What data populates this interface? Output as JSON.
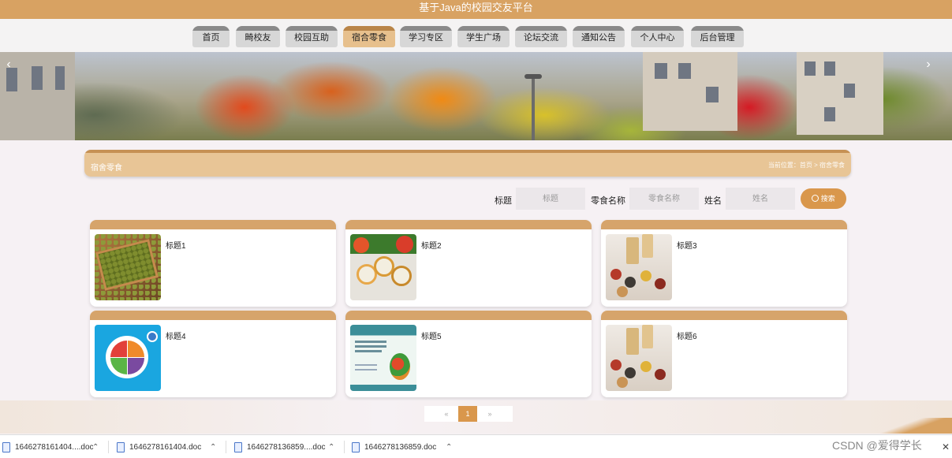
{
  "app": {
    "title": "基于Java的校园交友平台"
  },
  "nav": {
    "items": [
      {
        "label": "首页"
      },
      {
        "label": "畸校友"
      },
      {
        "label": "校园互助"
      },
      {
        "label": "宿合零食"
      },
      {
        "label": "学习专区"
      },
      {
        "label": "学生广场"
      },
      {
        "label": "论坛交流"
      },
      {
        "label": "通知公告"
      },
      {
        "label": "个人中心"
      },
      {
        "label": "后台管理"
      }
    ],
    "active_index": 3
  },
  "banner": {
    "prev_icon": "chevron-left-icon",
    "next_icon": "chevron-right-icon"
  },
  "section": {
    "title": "宿舍零食",
    "crumb": "当前位置：首页 > 宿舍零食"
  },
  "search": {
    "fields": [
      {
        "label": "标题",
        "placeholder": "标题"
      },
      {
        "label": "零食名称",
        "placeholder": "零食名称"
      },
      {
        "label": "姓名",
        "placeholder": "姓名"
      }
    ],
    "button_label": "搜索",
    "button_icon": "search-icon"
  },
  "cards": [
    {
      "title": "标题1",
      "image": "beans"
    },
    {
      "title": "标题2",
      "image": "salad-bowls"
    },
    {
      "title": "标题3",
      "image": "grain-jars"
    },
    {
      "title": "标题4",
      "image": "food-plate"
    },
    {
      "title": "标题5",
      "image": "nutrition-poster"
    },
    {
      "title": "标题6",
      "image": "grain-jars"
    }
  ],
  "pager": {
    "prev": "«",
    "current": "1",
    "next": "»"
  },
  "colors": {
    "accent": "#d8a262",
    "button": "#d9974c",
    "card_cap": "#d6a46b"
  },
  "downloads": [
    {
      "name": "1646278161404....doc"
    },
    {
      "name": "1646278161404.doc"
    },
    {
      "name": "1646278136859....doc"
    },
    {
      "name": "1646278136859.doc"
    }
  ],
  "watermark": "CSDN @爱得学长"
}
